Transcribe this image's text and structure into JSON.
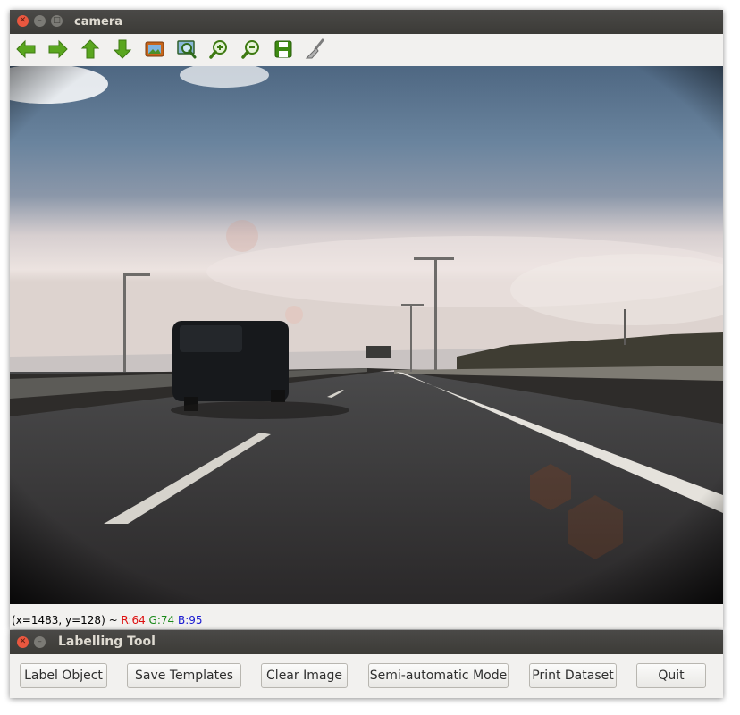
{
  "window": {
    "title": "camera"
  },
  "toolbar": {
    "icons": [
      "arrow-left-icon",
      "arrow-right-icon",
      "arrow-up-icon",
      "arrow-down-icon",
      "image-icon",
      "zoom-fit-icon",
      "zoom-in-icon",
      "zoom-out-icon",
      "save-icon",
      "brush-icon"
    ]
  },
  "status": {
    "coords": "(x=1483, y=128) ~ ",
    "r": "R:64",
    "g": "G:74",
    "b": "B:95"
  },
  "dialog": {
    "title": "Labelling Tool",
    "buttons": {
      "label_object": "Label Object",
      "save_templates": "Save Templates",
      "clear_image": "Clear Image",
      "semi_automatic": "Semi-automatic Mode",
      "print_dataset": "Print Dataset",
      "quit": "Quit"
    }
  },
  "colors": {
    "accent_green": "#5aa61f",
    "close_button": "#e9573f",
    "titlebar": "#3c3b37"
  }
}
